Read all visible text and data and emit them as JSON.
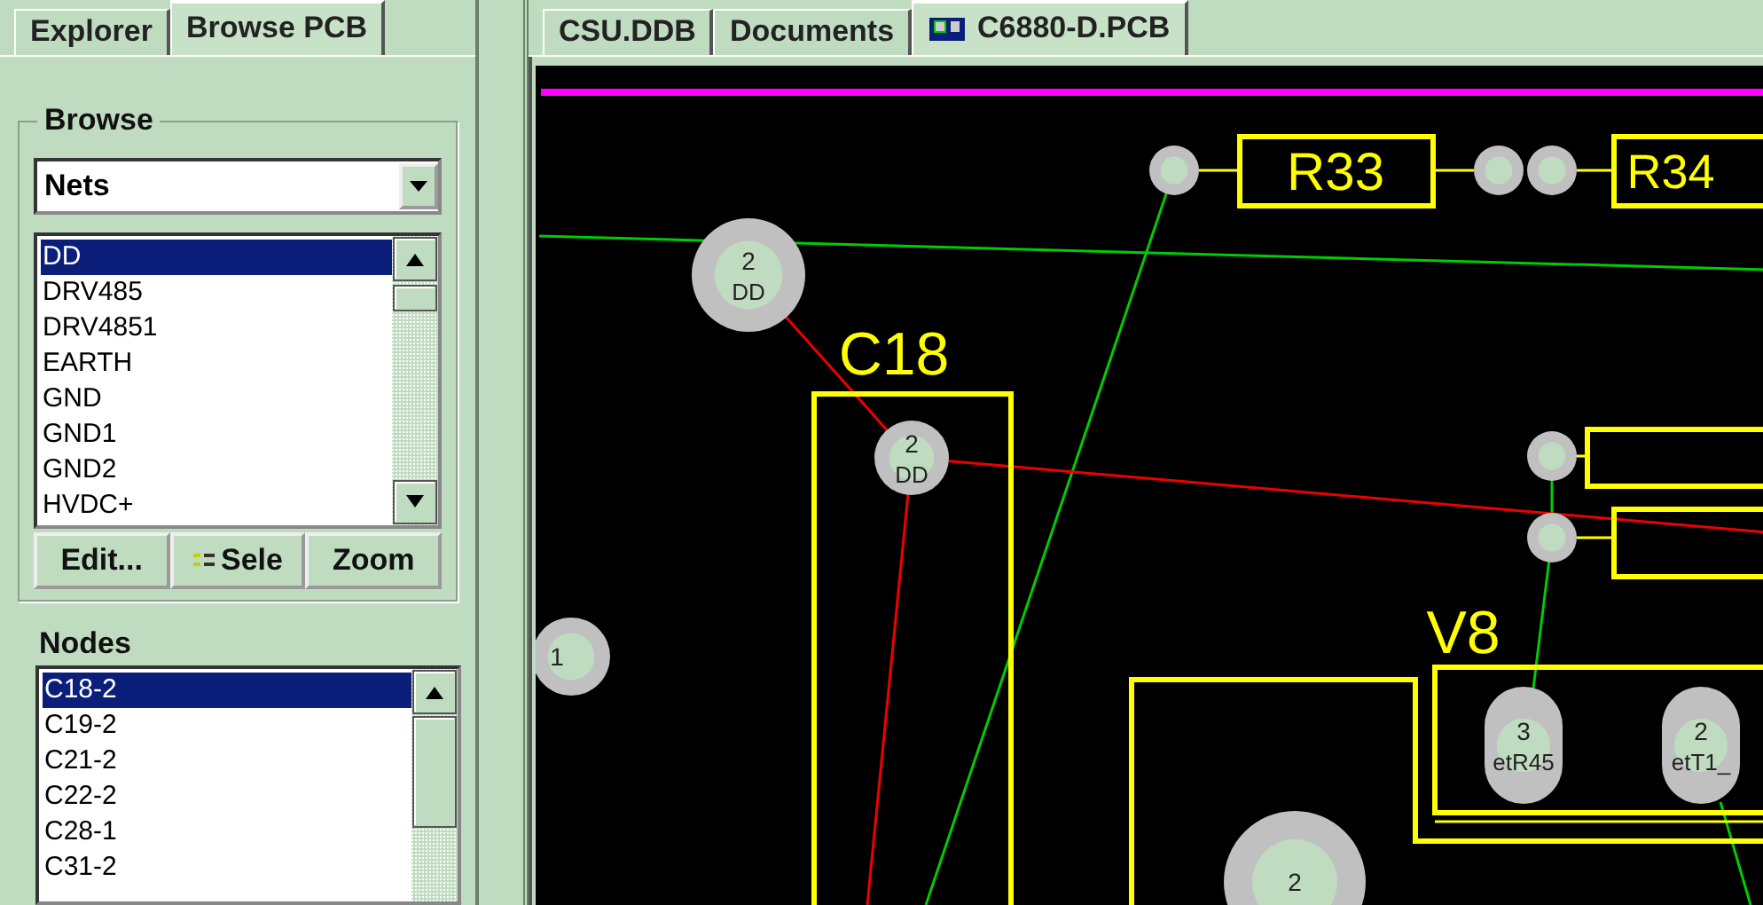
{
  "left_panel": {
    "tabs": [
      {
        "label": "Explorer",
        "selected": false
      },
      {
        "label": "Browse PCB",
        "selected": true
      }
    ],
    "browse": {
      "title": "Browse",
      "dropdown": {
        "value": "Nets"
      },
      "nets": [
        {
          "label": "DD",
          "selected": true
        },
        {
          "label": "DRV485",
          "selected": false
        },
        {
          "label": "DRV4851",
          "selected": false
        },
        {
          "label": "EARTH",
          "selected": false
        },
        {
          "label": "GND",
          "selected": false
        },
        {
          "label": "GND1",
          "selected": false
        },
        {
          "label": "GND2",
          "selected": false
        },
        {
          "label": "HVDC+",
          "selected": false
        }
      ],
      "buttons": [
        {
          "label": "Edit...",
          "kind": "text"
        },
        {
          "label": "Sele",
          "kind": "icon"
        },
        {
          "label": "Zoom",
          "kind": "text"
        }
      ]
    },
    "nodes": {
      "title": "Nodes",
      "items": [
        {
          "label": "C18-2",
          "selected": true
        },
        {
          "label": "C19-2",
          "selected": false
        },
        {
          "label": "C21-2",
          "selected": false
        },
        {
          "label": "C22-2",
          "selected": false
        },
        {
          "label": "C28-1",
          "selected": false
        },
        {
          "label": "C31-2",
          "selected": false
        }
      ]
    }
  },
  "document_tabs": [
    {
      "label": "CSU.DDB",
      "selected": false,
      "kind": "text"
    },
    {
      "label": "Documents",
      "selected": false,
      "kind": "text"
    },
    {
      "label": "C6880-D.PCB",
      "selected": true,
      "kind": "pcb"
    }
  ],
  "pcb": {
    "designators": [
      "R33",
      "R34",
      "C18",
      "V8"
    ],
    "pads": [
      {
        "number": "2",
        "net": "DD"
      },
      {
        "number": "2",
        "net": "DD"
      },
      {
        "number": "1"
      },
      {
        "number": "3",
        "net": "etR45"
      },
      {
        "number": "2",
        "net": "etT1_"
      },
      {
        "number": "2"
      }
    ]
  }
}
